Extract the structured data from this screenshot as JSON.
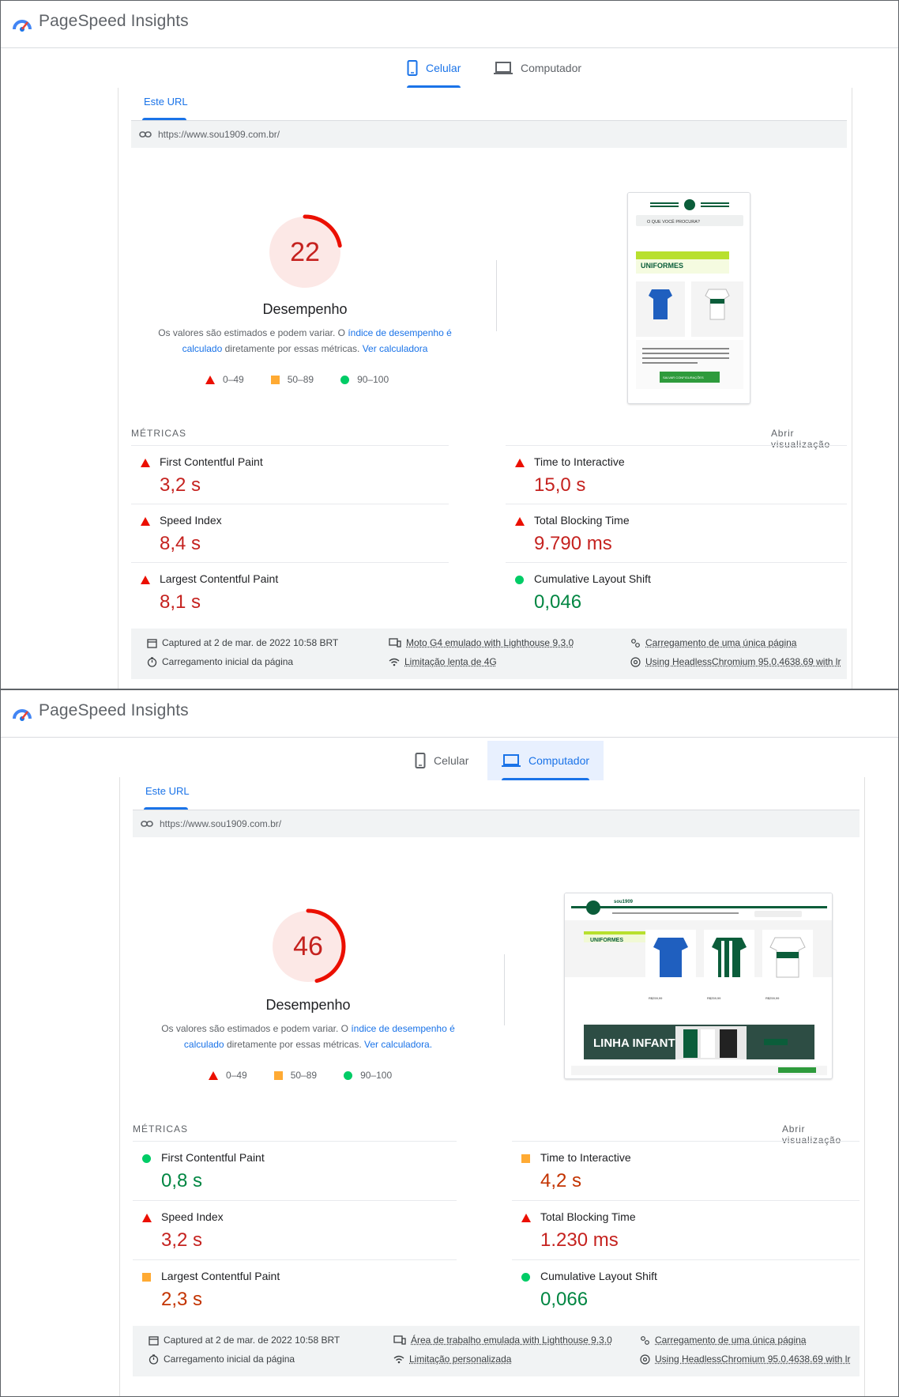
{
  "app": {
    "title": "PageSpeed Insights"
  },
  "panels": [
    {
      "tabs": {
        "mobile": "Celular",
        "desktop": "Computador"
      },
      "active_tab": "mobile",
      "url_tab": "Este URL",
      "url": "https://www.sou1909.com.br/",
      "score": 22,
      "score_label": "Desempenho",
      "note": {
        "part1": "Os valores são estimados e podem variar. O ",
        "link1": "índice de desempenho é calculado",
        "part2": " diretamente por essas métricas. ",
        "link2": "Ver calculadora"
      },
      "legend": [
        "0–49",
        "50–89",
        "90–100"
      ],
      "metrics_heading": "MÉTRICAS",
      "open_view": "Abrir visualização",
      "metrics": [
        {
          "name": "First Contentful Paint",
          "value": "3,2 s",
          "status": "red"
        },
        {
          "name": "Time to Interactive",
          "value": "15,0 s",
          "status": "red"
        },
        {
          "name": "Speed Index",
          "value": "8,4 s",
          "status": "red"
        },
        {
          "name": "Total Blocking Time",
          "value": "9.790 ms",
          "status": "red"
        },
        {
          "name": "Largest Contentful Paint",
          "value": "8,1 s",
          "status": "red"
        },
        {
          "name": "Cumulative Layout Shift",
          "value": "0,046",
          "status": "green"
        }
      ],
      "env": {
        "captured": "Captured at 2 de mar. de 2022 10:58 BRT",
        "initial": "Carregamento inicial da página",
        "device": "Moto G4 emulado with Lighthouse 9.3.0",
        "throttle": "Limitação lenta de 4G",
        "single": "Carregamento de uma única página",
        "browser": "Using HeadlessChromium 95.0.4638.69 with lr"
      },
      "thumb": {
        "search": "O QUE VOCÊ PROCURA?",
        "section": "UNIFORMES",
        "button": "SALVAR CONFIGURAÇÕES"
      }
    },
    {
      "tabs": {
        "mobile": "Celular",
        "desktop": "Computador"
      },
      "active_tab": "desktop",
      "url_tab": "Este URL",
      "url": "https://www.sou1909.com.br/",
      "score": 46,
      "score_label": "Desempenho",
      "note": {
        "part1": "Os valores são estimados e podem variar. O ",
        "link1": "índice de desempenho é calculado",
        "part2": " diretamente por essas métricas. ",
        "link2": "Ver calculadora."
      },
      "legend": [
        "0–49",
        "50–89",
        "90–100"
      ],
      "metrics_heading": "MÉTRICAS",
      "open_view": "Abrir visualização",
      "metrics": [
        {
          "name": "First Contentful Paint",
          "value": "0,8 s",
          "status": "green"
        },
        {
          "name": "Time to Interactive",
          "value": "4,2 s",
          "status": "orange"
        },
        {
          "name": "Speed Index",
          "value": "3,2 s",
          "status": "red"
        },
        {
          "name": "Total Blocking Time",
          "value": "1.230 ms",
          "status": "red"
        },
        {
          "name": "Largest Contentful Paint",
          "value": "2,3 s",
          "status": "orange"
        },
        {
          "name": "Cumulative Layout Shift",
          "value": "0,066",
          "status": "green"
        }
      ],
      "env": {
        "captured": "Captured at 2 de mar. de 2022 10:58 BRT",
        "initial": "Carregamento inicial da página",
        "device": "Área de trabalho emulada with Lighthouse 9.3.0",
        "throttle": "Limitação personalizada",
        "single": "Carregamento de uma única página",
        "browser": "Using HeadlessChromium 95.0.4638.69 with lr"
      },
      "thumb": {
        "brand": "sou1909",
        "section": "UNIFORMES",
        "banner": "LINHA INFANTIL",
        "prices": [
          "R$259,99",
          "R$259,99",
          "R$259,99"
        ]
      }
    }
  ]
}
